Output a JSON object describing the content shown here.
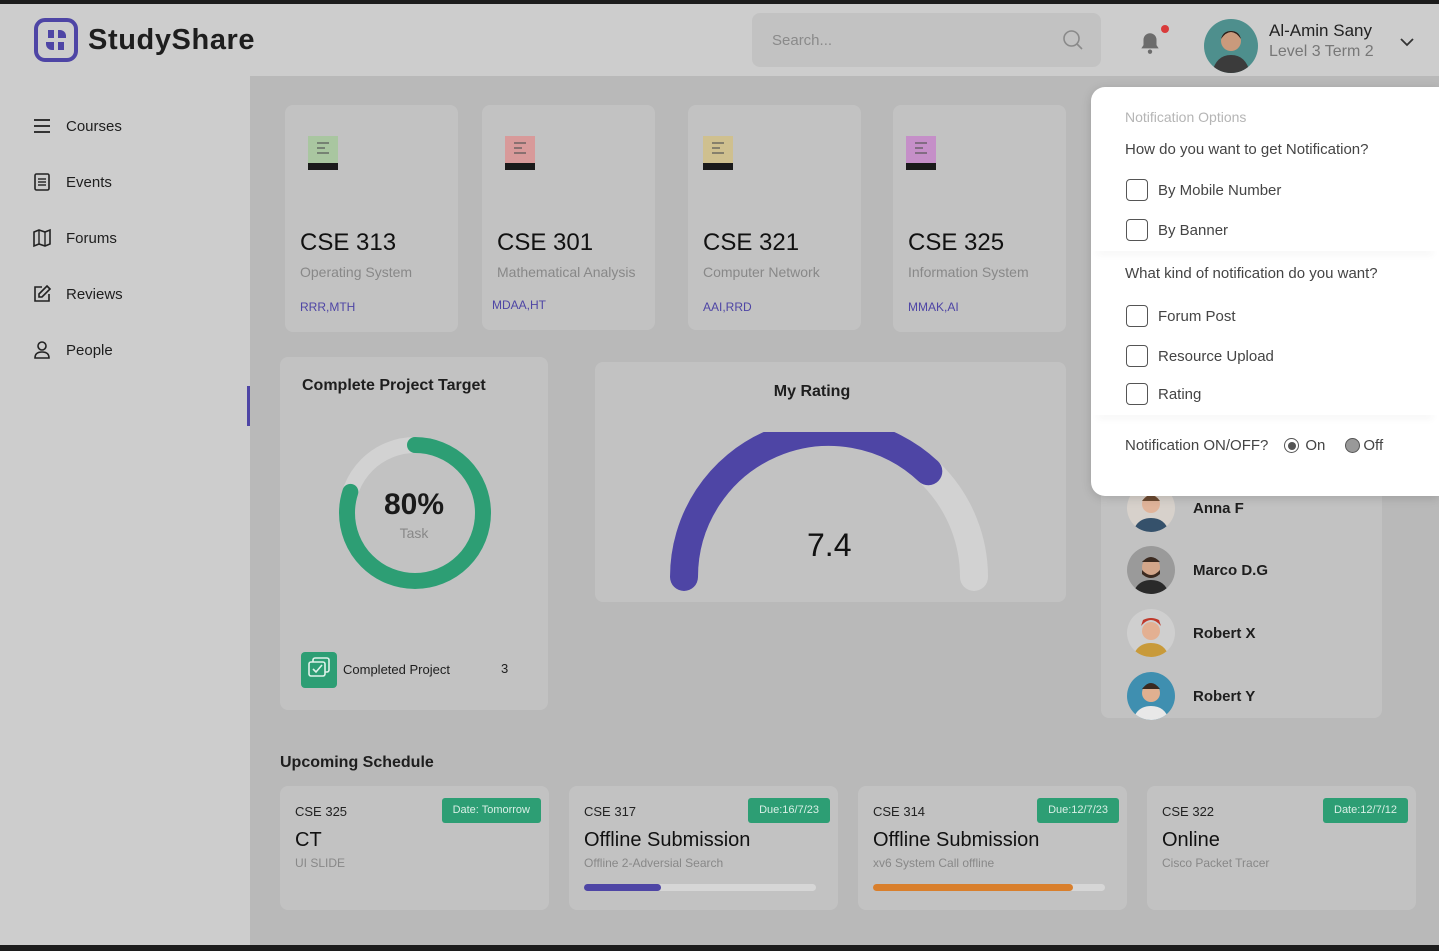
{
  "app": {
    "brand": "StudyShare"
  },
  "header": {
    "search_placeholder": "Search...",
    "user": {
      "name": "Al-Amin Sany",
      "level": "Level 3 Term 2"
    }
  },
  "sidebar": {
    "items": [
      {
        "label": "Courses",
        "icon": "menu-icon"
      },
      {
        "label": "Events",
        "icon": "document-icon"
      },
      {
        "label": "Forums",
        "icon": "map-icon"
      },
      {
        "label": "Reviews",
        "icon": "edit-icon"
      },
      {
        "label": "People",
        "icon": "person-icon"
      }
    ]
  },
  "courses": [
    {
      "code": "CSE 313",
      "name": "Operating System",
      "teachers": "RRR,MTH",
      "color": "#a9c6a0"
    },
    {
      "code": "CSE 301",
      "name": "Mathematical Analysis",
      "teachers": "MDAA,HT",
      "color": "#d89a9a"
    },
    {
      "code": "CSE 321",
      "name": "Computer Network",
      "teachers": "AAI,RRD",
      "color": "#cfc08f"
    },
    {
      "code": "CSE 325",
      "name": "Information System",
      "teachers": "MMAK,AI",
      "color": "#c58fc8"
    }
  ],
  "project": {
    "title": "Complete Project Target",
    "percent": "80%",
    "percent_value": 80,
    "label": "Task",
    "completed_label": "Completed Project",
    "completed_count": "3"
  },
  "rating": {
    "title": "My Rating",
    "value": "7.4",
    "fraction": 0.74
  },
  "people": [
    {
      "name": "Anna F"
    },
    {
      "name": "Marco D.G"
    },
    {
      "name": "Robert X"
    },
    {
      "name": "Robert Y"
    }
  ],
  "schedule": {
    "title": "Upcoming Schedule",
    "items": [
      {
        "code": "CSE 325",
        "badge": "Date: Tomorrow",
        "title": "CT",
        "subtitle": "UI SLIDE"
      },
      {
        "code": "CSE 317",
        "badge": "Due:16/7/23",
        "title": "Offline Submission",
        "subtitle": "Offline 2-Adversial Search",
        "progress": 0.33,
        "progress_color": "#4e45a5"
      },
      {
        "code": "CSE 314",
        "badge": "Due:12/7/23",
        "title": "Offline Submission",
        "subtitle": "xv6 System Call offline",
        "progress": 0.86,
        "progress_color": "#d97f2c"
      },
      {
        "code": "CSE 322",
        "badge": "Date:12/7/12",
        "title": "Online",
        "subtitle": "Cisco Packet Tracer"
      }
    ]
  },
  "notifications": {
    "heading": "Notification Options",
    "q1": "How do you want to get Notification?",
    "q1_options": [
      "By Mobile Number",
      "By Banner"
    ],
    "q2": "What kind of notification do you want?",
    "q2_options": [
      "Forum Post",
      "Resource Upload",
      "Rating"
    ],
    "toggle_label": "Notification ON/OFF?",
    "on_label": "On",
    "off_label": "Off",
    "selected": "On"
  },
  "colors": {
    "accent": "#4e45a5",
    "green": "#2d9e74",
    "orange": "#d97f2c"
  }
}
